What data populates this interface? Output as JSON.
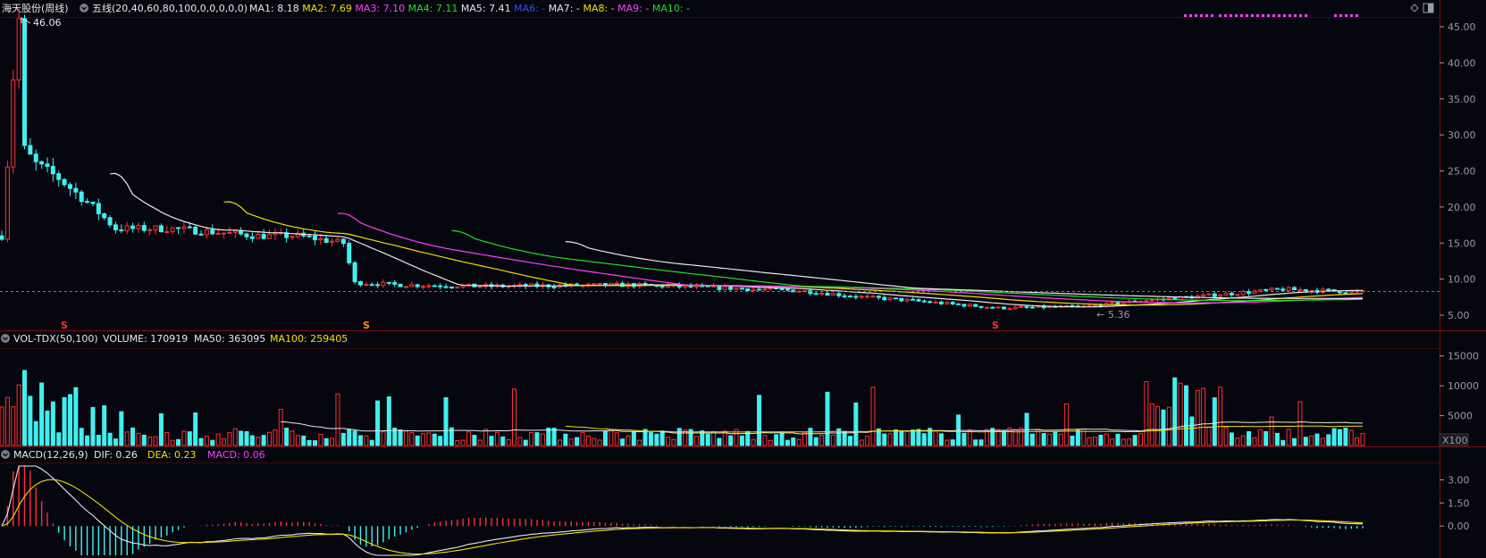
{
  "header": {
    "stock_name": "海天股份(周线)",
    "indicator": "五线(20,40,60,80,100,0,0,0,0,0)",
    "ma": [
      {
        "label": "MA1: 8.18",
        "color": "#e8e8e8"
      },
      {
        "label": "MA2: 7.69",
        "color": "#f0e000"
      },
      {
        "label": "MA3: 7.10",
        "color": "#ff3cff"
      },
      {
        "label": "MA4: 7.11",
        "color": "#20e020"
      },
      {
        "label": "MA5: 7.41",
        "color": "#e8e8e8"
      },
      {
        "label": "MA6: -",
        "color": "#3050ff"
      },
      {
        "label": "MA7: -",
        "color": "#e8e8e8"
      },
      {
        "label": "MA8: -",
        "color": "#f0e000"
      },
      {
        "label": "MA9: -",
        "color": "#ff3cff"
      },
      {
        "label": "MA10: -",
        "color": "#20e020"
      }
    ]
  },
  "price_axis": {
    "ticks": [
      "45.00",
      "40.00",
      "35.00",
      "30.00",
      "25.00",
      "20.00",
      "15.00",
      "10.00",
      "5.00"
    ]
  },
  "annotations": {
    "high": "46.06",
    "low": "5.36",
    "marker": "S"
  },
  "volume": {
    "title": "VOL-TDX(50,100)",
    "volume_label": "VOLUME: 170919",
    "ma50_label": "MA50: 363095",
    "ma100_label": "MA100: 259405",
    "ticks": [
      "15000",
      "10000",
      "5000"
    ],
    "unit": "X100"
  },
  "macd": {
    "title": "MACD(12,26,9)",
    "dif_label": "DIF: 0.26",
    "dea_label": "DEA: 0.23",
    "macd_label": "MACD: 0.06",
    "ticks": [
      "3.00",
      "1.50",
      "0.00"
    ]
  },
  "colors": {
    "bg": "#06060f",
    "grid": "#7a1010",
    "up": "#ff3030",
    "down": "#40f0f0",
    "ma1": "#e8e8e8",
    "ma2": "#f0e000",
    "ma3": "#ff3cff",
    "ma4": "#20e020",
    "ma5": "#e8e8e8",
    "axis_text": "#9a9aa8",
    "dots": "#ff3cff"
  }
}
